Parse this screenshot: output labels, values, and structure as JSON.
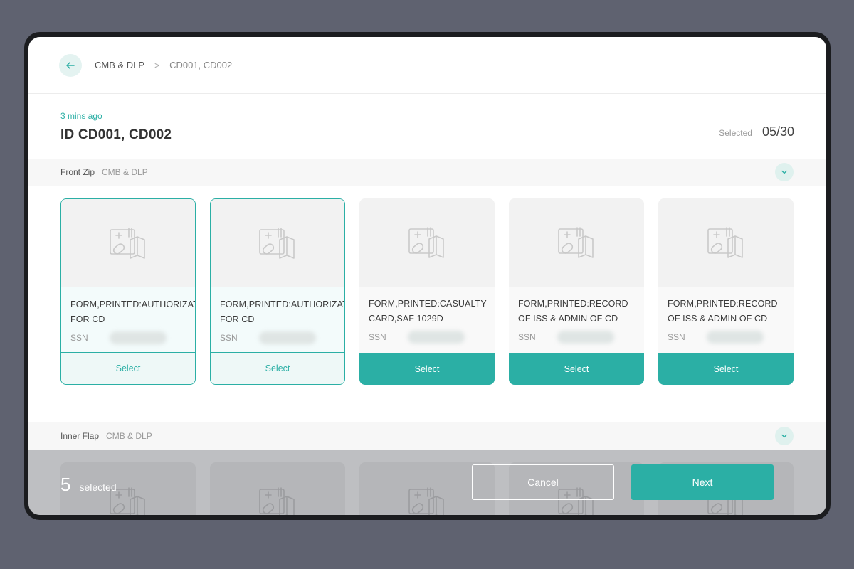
{
  "colors": {
    "accent": "#2bafa5",
    "background": "#5f6270"
  },
  "breadcrumb": {
    "parent": "CMB & DLP",
    "separator": ">",
    "current": "CD001, CD002"
  },
  "header": {
    "time": "3 mins ago",
    "title": "ID CD001, CD002",
    "selected_label": "Selected",
    "selected_count": "05/30"
  },
  "sections": [
    {
      "name": "Front Zip",
      "sub": "CMB & DLP"
    },
    {
      "name": "Inner Flap",
      "sub": "CMB & DLP"
    }
  ],
  "cards": [
    {
      "name": "FORM,PRINTED:AUTHORIZATION FOR CD",
      "ssn_label": "SSN",
      "button": "Select",
      "selected": true
    },
    {
      "name": "FORM,PRINTED:AUTHORIZATION FOR CD",
      "ssn_label": "SSN",
      "button": "Select",
      "selected": true
    },
    {
      "name": "FORM,PRINTED:CASUALTY CARD,SAF 1029D",
      "ssn_label": "SSN",
      "button": "Select",
      "selected": false
    },
    {
      "name": "FORM,PRINTED:RECORD OF ISS & ADMIN OF CD",
      "ssn_label": "SSN",
      "button": "Select",
      "selected": false
    },
    {
      "name": "FORM,PRINTED:RECORD OF ISS & ADMIN OF CD",
      "ssn_label": "SSN",
      "button": "Select",
      "selected": false
    }
  ],
  "footer": {
    "count": "5",
    "selected_word": "selected",
    "cancel": "Cancel",
    "next": "Next"
  },
  "icons": {
    "back": "arrow-left-icon",
    "expand": "chevron-down-icon",
    "document": "document-placeholder-icon"
  }
}
